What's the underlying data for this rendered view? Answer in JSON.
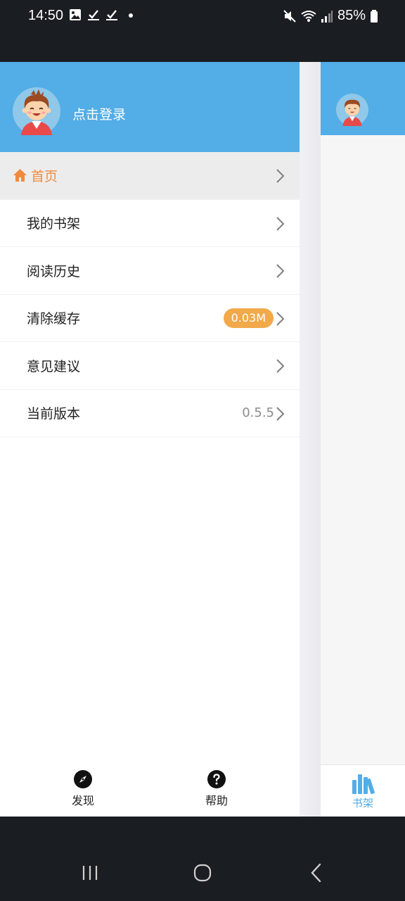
{
  "status_bar": {
    "time": "14:50",
    "battery": "85%"
  },
  "drawer": {
    "login_label": "点击登录",
    "menu": [
      {
        "label": "首页",
        "active": true
      },
      {
        "label": "我的书架"
      },
      {
        "label": "阅读历史"
      },
      {
        "label": "清除缓存",
        "badge": "0.03M"
      },
      {
        "label": "意见建议"
      },
      {
        "label": "当前版本",
        "value": "0.5.5"
      }
    ],
    "footer": {
      "discover_label": "发现",
      "help_label": "帮助"
    }
  },
  "main": {
    "tab_bookshelf_label": "书架"
  },
  "colors": {
    "header_blue": "#53ade6",
    "accent_orange": "#f08b3e",
    "badge_orange": "#f1a94a"
  }
}
